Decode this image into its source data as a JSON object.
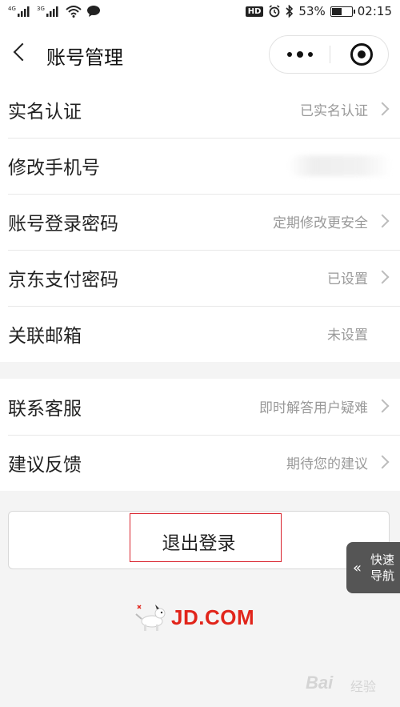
{
  "status_bar": {
    "signal_1": "4G",
    "signal_2": "3G",
    "hd": "HD",
    "battery_percent": "53%",
    "battery_level": 0.53,
    "time": "02:15"
  },
  "nav": {
    "title": "账号管理"
  },
  "group1": [
    {
      "label": "实名认证",
      "value": "已实名认证",
      "chevron": true
    },
    {
      "label": "修改手机号",
      "value": "",
      "blurred": true
    },
    {
      "label": "账号登录密码",
      "value": "定期修改更安全",
      "chevron": true
    },
    {
      "label": "京东支付密码",
      "value": "已设置",
      "chevron": true
    },
    {
      "label": "关联邮箱",
      "value": "未设置",
      "chevron": false
    }
  ],
  "group2": [
    {
      "label": "联系客服",
      "value": "即时解答用户疑难",
      "chevron": true
    },
    {
      "label": "建议反馈",
      "value": "期待您的建议",
      "chevron": true
    }
  ],
  "logout": {
    "label": "退出登录"
  },
  "quick_nav": {
    "line1": "快速",
    "line2": "导航"
  },
  "logo": {
    "text": "JD.COM"
  },
  "watermark": {
    "text": "Bai",
    "sub": "经验"
  },
  "colors": {
    "brand": "#e1251b",
    "highlight": "#d9232d"
  }
}
